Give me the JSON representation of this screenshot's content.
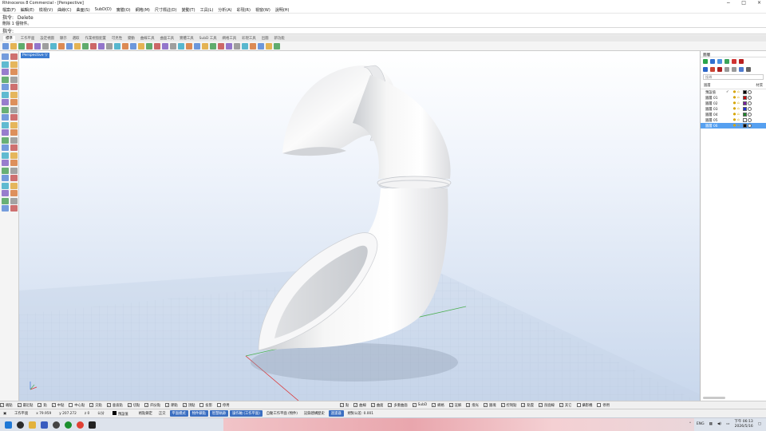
{
  "window": {
    "title": "Rhinoceros 8 Commercial - [Perspective]",
    "controls": [
      "−",
      "□",
      "×"
    ]
  },
  "menu": [
    "檔案(F)",
    "編輯(E)",
    "檢視(V)",
    "曲線(C)",
    "曲面(S)",
    "SubD(D)",
    "實體(O)",
    "網格(M)",
    "尺寸標註(D)",
    "變動(T)",
    "工具(L)",
    "分析(A)",
    "彩現(R)",
    "視窗(W)",
    "說明(H)"
  ],
  "command": {
    "line1": "指令: _Delete",
    "line2": "刪除 1 個物件。",
    "prompt": "指令:"
  },
  "tabs": [
    "標準",
    "工作平面",
    "設定視圖",
    "顯示",
    "選取",
    "作業視窗配置",
    "可見性",
    "變動",
    "曲線工具",
    "曲面工具",
    "實體工具",
    "SubD 工具",
    "網格工具",
    "彩現工具",
    "出圖",
    "新功能"
  ],
  "toolbar_icons": [
    "new-icon",
    "open-icon",
    "save-icon",
    "print-icon",
    "import-icon",
    "cut-icon",
    "copy-icon",
    "paste-icon",
    "undo-icon",
    "pan-icon",
    "rotate-view-icon",
    "zoom-icon",
    "zoom-window-icon",
    "zoom-extents-icon",
    "zoom-selected-icon",
    "zoom-dynamic-icon",
    "grid-icon",
    "select-all-icon",
    "points-icon",
    "control-points-icon",
    "lasso-icon",
    "light-icon",
    "object-properties-icon",
    "render-icon",
    "color-wheel-icon",
    "material-icon",
    "display-mode-icon",
    "shaded-icon",
    "rendered-icon",
    "ghost-icon",
    "xray-icon",
    "options-icon",
    "named-views-icon",
    "history-icon",
    "help-icon"
  ],
  "viewport": {
    "label": "Perspective ▽"
  },
  "panel": {
    "title": "圖層",
    "search_placeholder": "搜尋",
    "col_layer": "圖層",
    "col_material": "材質",
    "layers": [
      {
        "name": "預設值",
        "check": "✓",
        "color": "#000000",
        "selected": false
      },
      {
        "name": "圖層 01",
        "check": "",
        "color": "#cc0000",
        "selected": false
      },
      {
        "name": "圖層 02",
        "check": "",
        "color": "#7a1fa2",
        "selected": false
      },
      {
        "name": "圖層 03",
        "check": "",
        "color": "#1c2fd6",
        "selected": false
      },
      {
        "name": "圖層 04",
        "check": "",
        "color": "#1c8a2a",
        "selected": false
      },
      {
        "name": "圖層 05",
        "check": "",
        "color": "#ffffff",
        "selected": false
      },
      {
        "name": "圖層 06",
        "check": "",
        "color": "#000000",
        "selected": true
      }
    ]
  },
  "snaps_left": [
    {
      "label": "端點",
      "on": true
    },
    {
      "label": "最近點",
      "on": true
    },
    {
      "label": "點",
      "on": true
    },
    {
      "label": "中點",
      "on": true
    },
    {
      "label": "中心點",
      "on": false
    },
    {
      "label": "交點",
      "on": true
    },
    {
      "label": "垂直點",
      "on": true
    },
    {
      "label": "切點",
      "on": true
    },
    {
      "label": "四分點",
      "on": true
    },
    {
      "label": "節點",
      "on": true
    },
    {
      "label": "頂點",
      "on": true
    },
    {
      "label": "投影",
      "on": false
    },
    {
      "label": "停用",
      "on": false
    }
  ],
  "snaps_right": [
    {
      "label": "點",
      "on": true
    },
    {
      "label": "曲線",
      "on": true
    },
    {
      "label": "曲面",
      "on": true
    },
    {
      "label": "多重曲面",
      "on": true
    },
    {
      "label": "SubD",
      "on": true
    },
    {
      "label": "網格",
      "on": true
    },
    {
      "label": "註解",
      "on": true
    },
    {
      "label": "燈光",
      "on": true
    },
    {
      "label": "圖塊",
      "on": true
    },
    {
      "label": "控制點",
      "on": true
    },
    {
      "label": "點雲",
      "on": true
    },
    {
      "label": "剖面線",
      "on": true
    },
    {
      "label": "其它",
      "on": true
    },
    {
      "label": "攝影機",
      "on": false
    },
    {
      "label": "停用",
      "on": false
    }
  ],
  "status": {
    "cplane": "工作平面",
    "x": "x 79.959",
    "y": "y 207.272",
    "z": "z 0",
    "units": "公分",
    "layer": "預設值",
    "grid_snap": "格點鎖定",
    "ortho": "正交",
    "planar": "平面模式",
    "osnap": "物件鎖點",
    "smarttrack": "智慧軌跡",
    "gumball": "操作軸 (工作平面)",
    "record": "自動工作平面 (物件)",
    "history": "記錄建構歷史",
    "filter": "過濾器",
    "tolerance": "絕對公差: 0.001"
  },
  "taskbar": {
    "lang": "ENG",
    "time": "下午 06:13",
    "date": "2026/5/16"
  }
}
